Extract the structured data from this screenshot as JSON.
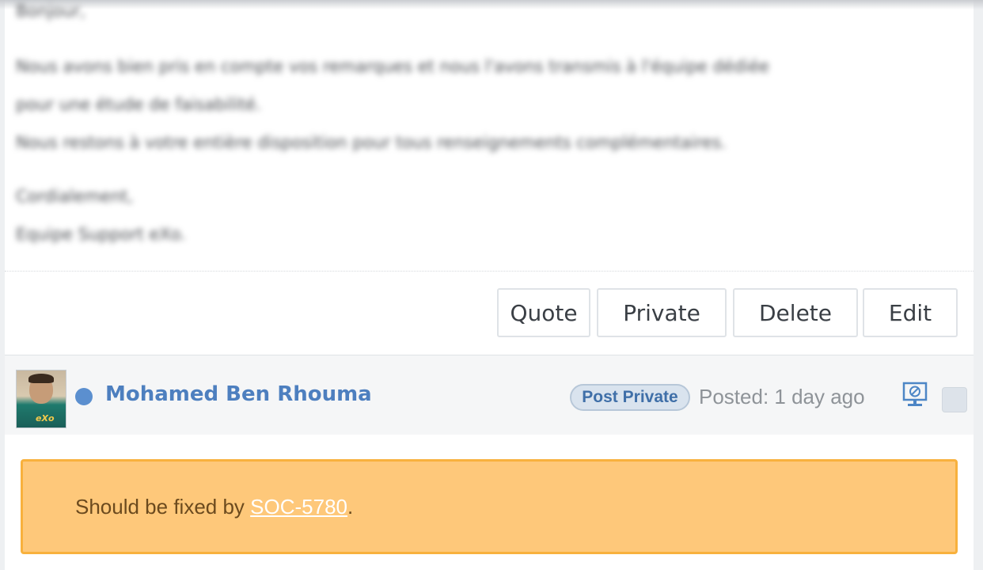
{
  "message": {
    "lines": [
      "Bonjour,",
      "Nous avons bien pris en compte vos remarques et nous l'avons transmis à l'équipe dédiée",
      "pour une étude de faisabilité.",
      "Nous restons à votre entière disposition pour tous renseignements complémentaires.",
      "Cordialement,",
      "Equipe Support eXo."
    ]
  },
  "actions": {
    "quote": "Quote",
    "private": "Private",
    "delete": "Delete",
    "edit": "Edit"
  },
  "post": {
    "author": "Mohamed Ben Rhouma",
    "badge": "Post Private",
    "posted": "Posted: 1 day ago",
    "avatar_logo": "eXo",
    "status_icon": "online-dot-icon",
    "note_prefix": "Should be fixed by ",
    "note_link": "SOC-5780",
    "note_suffix": "."
  },
  "colors": {
    "author": "#4d7fbf",
    "note_bg": "#fec87a",
    "note_border": "#f8b13d",
    "badge_bg": "#d9e3ee"
  }
}
